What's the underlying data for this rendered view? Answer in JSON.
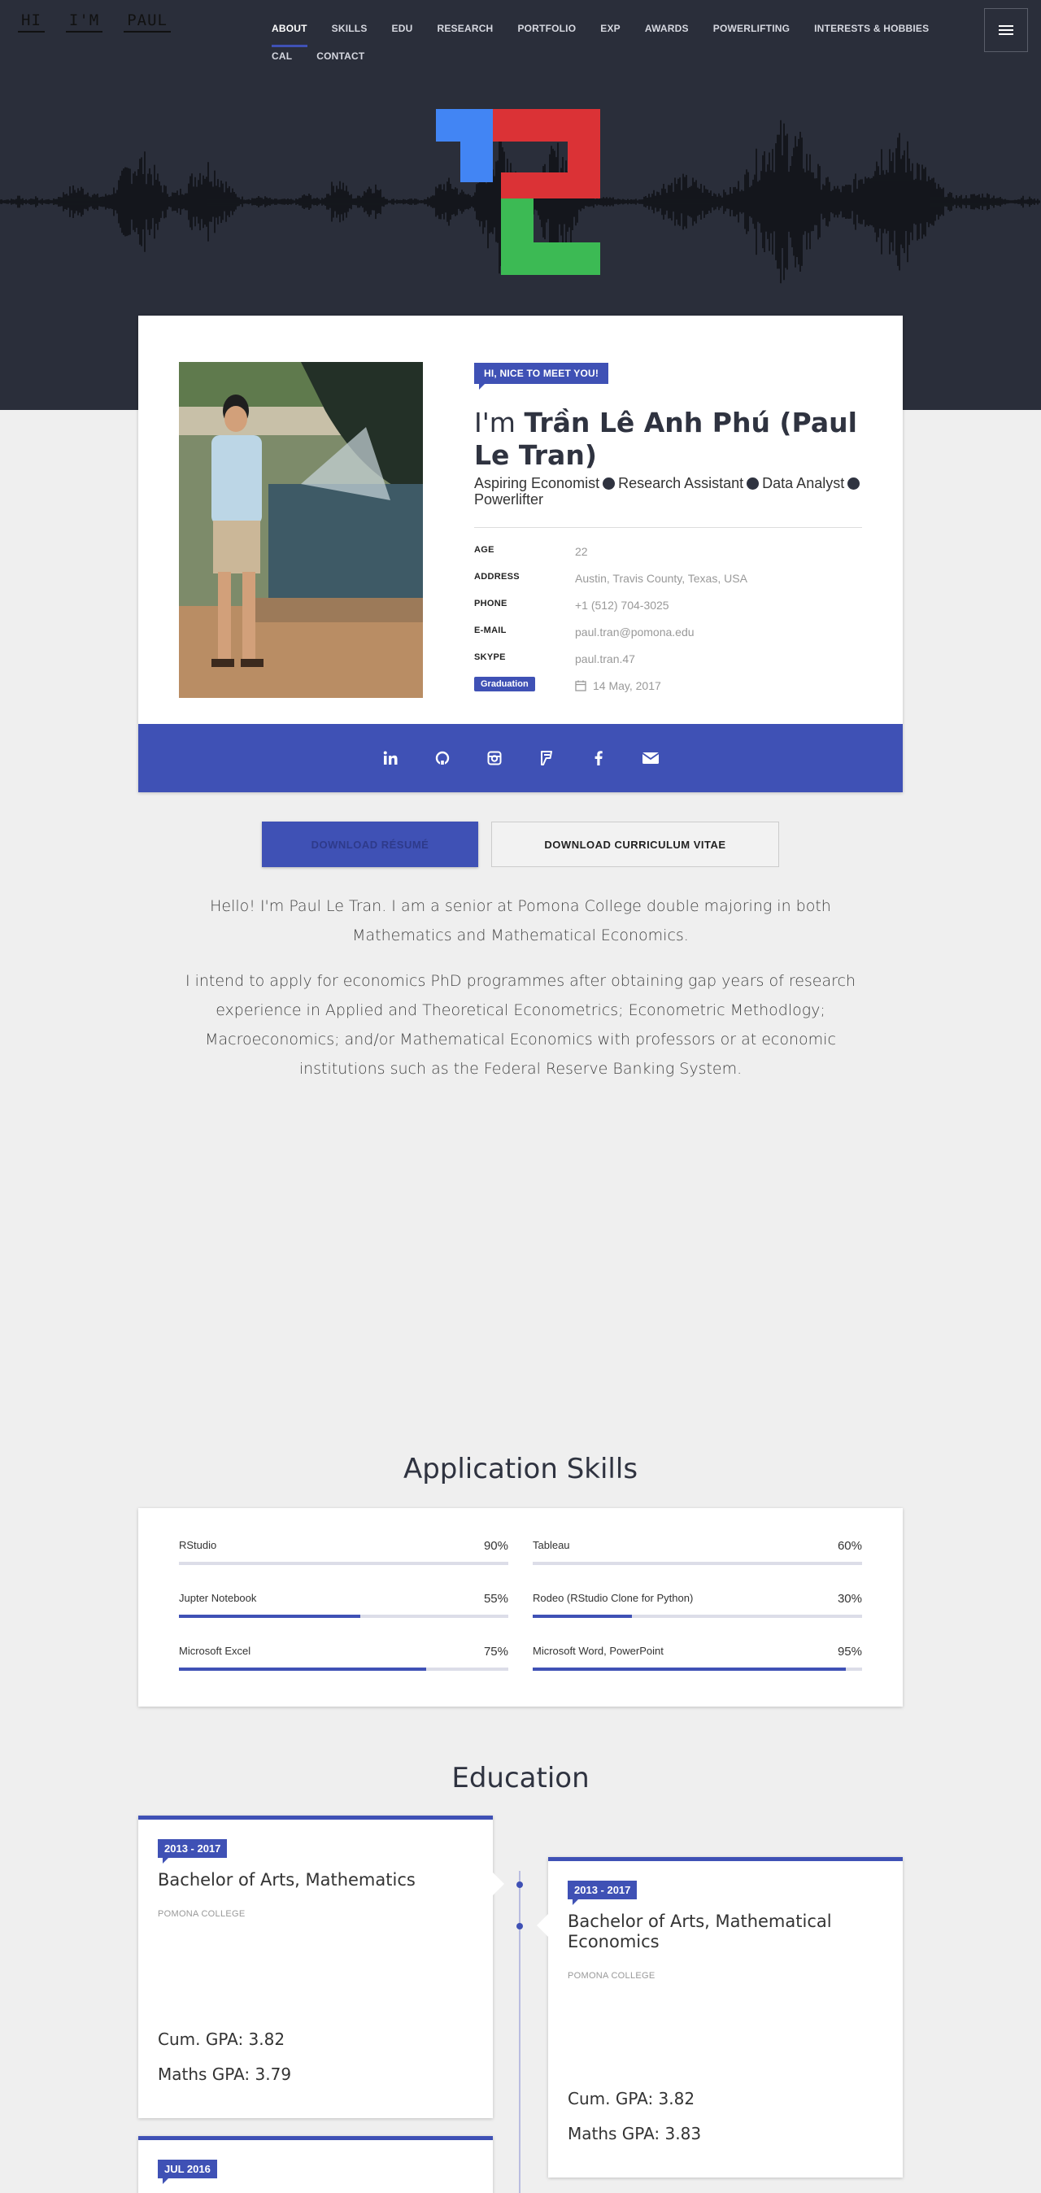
{
  "logo": [
    "HI",
    "I'M",
    "PAUL"
  ],
  "nav": {
    "row1": [
      "ABOUT",
      "SKILLS",
      "EDU",
      "RESEARCH",
      "PORTFOLIO",
      "EXP",
      "AWARDS",
      "POWERLIFTING",
      "INTERESTS & HOBBIES"
    ],
    "row2": [
      "CAL",
      "CONTACT"
    ],
    "active": "ABOUT"
  },
  "colors": {
    "accent": "#3f51b5",
    "header_bg": "#2a2e3a",
    "page_bg": "#efefef",
    "logo_blue": "#4285f4",
    "logo_red": "#db3236",
    "logo_green": "#3cba54"
  },
  "profile": {
    "greeting": "HI, NICE TO MEET YOU!",
    "name_prefix": "I'm ",
    "name": "Trần Lê Anh Phú (Paul Le Tran)",
    "roles": [
      "Aspiring Economist",
      "Research Assistant",
      "Data Analyst",
      "Powerlifter"
    ],
    "info": [
      {
        "label": "AGE",
        "value": "22"
      },
      {
        "label": "ADDRESS",
        "value": "Austin, Travis County, Texas, USA"
      },
      {
        "label": "PHONE",
        "value": "+1 (512) 704-3025"
      },
      {
        "label": "E-MAIL",
        "value": "paul.tran@pomona.edu"
      },
      {
        "label": "SKYPE",
        "value": "paul.tran.47"
      }
    ],
    "graduation_label": "Graduation",
    "graduation_date": "14 May, 2017",
    "social_icons": [
      "linkedin-icon",
      "github-icon",
      "instagram-icon",
      "foursquare-icon",
      "facebook-icon",
      "envelope-icon"
    ]
  },
  "buttons": {
    "resume": "DOWNLOAD RÉSUMÉ",
    "cv": "DOWNLOAD CURRICULUM VITAE"
  },
  "bio": [
    "Hello! I'm Paul Le Tran. I am a senior at Pomona College double majoring in both Mathematics and Mathematical Economics.",
    "I intend to apply for economics PhD programmes after obtaining gap years of research experience in Applied and Theoretical Econometrics; Econometric Methodlogy; Macroeconomics; and/or Mathematical Economics with professors or at economic institutions such as the Federal Reserve Banking System."
  ],
  "skills": {
    "title": "Application Skills",
    "items": [
      {
        "name": "RStudio",
        "percent": 90,
        "label": "90%"
      },
      {
        "name": "Tableau",
        "percent": 60,
        "label": "60%"
      },
      {
        "name": "Jupter Notebook",
        "percent": 55,
        "label": "55%"
      },
      {
        "name": "Rodeo (RStudio Clone for Python)",
        "percent": 30,
        "label": "30%"
      },
      {
        "name": "Microsoft Excel",
        "percent": 75,
        "label": "75%"
      },
      {
        "name": "Microsoft Word, PowerPoint",
        "percent": 95,
        "label": "95%"
      }
    ]
  },
  "education": {
    "title": "Education",
    "items": [
      {
        "date": "2013 - 2017",
        "degree": "Bachelor of Arts, Mathematics",
        "school": "POMONA COLLEGE",
        "gpa1": "Cum. GPA: 3.82",
        "gpa2": "Maths GPA: 3.79"
      },
      {
        "date": "2013 - 2017",
        "degree": "Bachelor of Arts, Mathematical Economics",
        "school": "POMONA COLLEGE",
        "gpa1": "Cum. GPA: 3.82",
        "gpa2": "Maths GPA: 3.83"
      },
      {
        "date": "JUL 2016"
      }
    ]
  }
}
